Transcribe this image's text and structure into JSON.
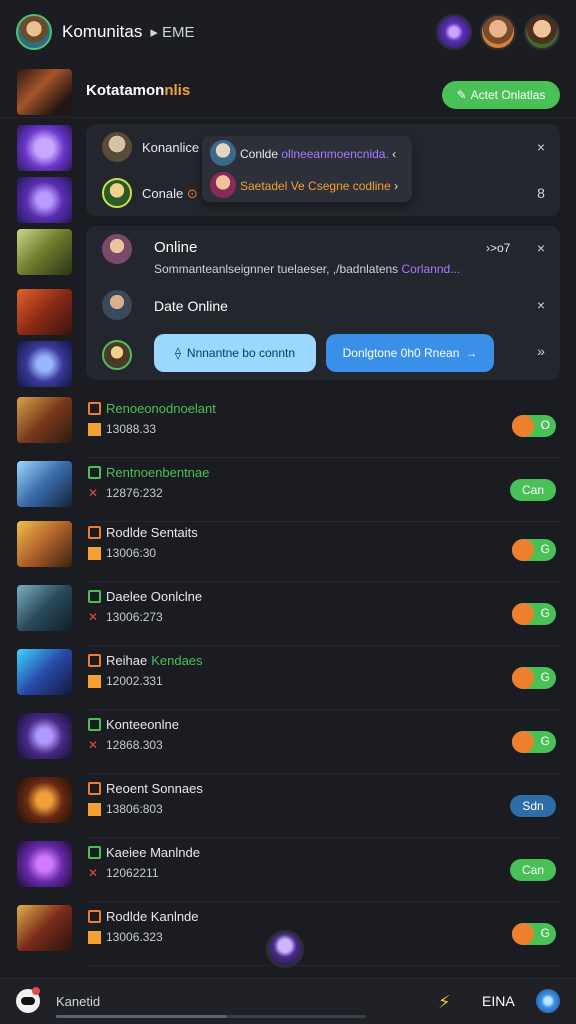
{
  "header": {
    "title": "Komunitas",
    "subtitle": "▸ EME"
  },
  "community": {
    "title_main": "Kotatamon",
    "title_accent": "nlis",
    "button_label": "Actet Onlatlas"
  },
  "card1": {
    "rows": [
      {
        "name": "Konanlice",
        "close": "×"
      },
      {
        "name": "Conale",
        "close": "8"
      }
    ],
    "popover": [
      {
        "label": "Conlde",
        "text": "ollneeanmoencnida.",
        "chevron": "‹"
      },
      {
        "text": "Saetadel Ve Csegne codline",
        "chevron": "›"
      }
    ]
  },
  "card2": {
    "online_title": "Online",
    "online_meta": "›>o7",
    "online_desc": "Sommanteanlseignner tuelaeser, ,/badnlatens",
    "online_desc_accent": "Corlannd...",
    "date_title": "Date Online",
    "btn_light": "Nnnantne bo conntn",
    "btn_dark": "Donlgtone 0h0 Rnean",
    "close": "×",
    "more": "»"
  },
  "rows": [
    {
      "name": "Renoeonodnoelant",
      "name_color": "#49c156",
      "num": "13088.33",
      "status": "toggle",
      "status_text": "O"
    },
    {
      "name": "Rentnoenbentnae",
      "name_color": "#49c156",
      "num": "12876:232",
      "status": "pill-green",
      "status_text": "Can"
    },
    {
      "name": "Rodlde Sentaits",
      "name_color": "#e7e9ee",
      "num": "13006:30",
      "status": "toggle",
      "status_text": "G"
    },
    {
      "name": "Daelee Oonlclne",
      "name_color": "#e7e9ee",
      "num": "13006:273",
      "status": "toggle",
      "status_text": "G"
    },
    {
      "name": "Reihae",
      "name_accent": "Kendaes",
      "name_color": "#e7e9ee",
      "num": "12002.331",
      "status": "toggle",
      "status_text": "G"
    },
    {
      "name": "Konteeonlne",
      "name_color": "#e7e9ee",
      "num": "12868.303",
      "status": "toggle",
      "status_text": "G"
    },
    {
      "name": "Reoent Sonnaes",
      "name_color": "#e7e9ee",
      "num": "13806:803",
      "status": "pill-blue",
      "status_text": "Sdn"
    },
    {
      "name": "Kaeiee Manlnde",
      "name_color": "#e7e9ee",
      "num": "12062211",
      "status": "pill-green",
      "status_text": "Can"
    },
    {
      "name": "Rodlde Kanlnde",
      "name_color": "#e7e9ee",
      "num": "13006.323",
      "status": "toggle",
      "status_text": "G"
    }
  ],
  "bottom": {
    "label": "Kanetid",
    "right_label": "EINA",
    "progress": 0.55
  }
}
